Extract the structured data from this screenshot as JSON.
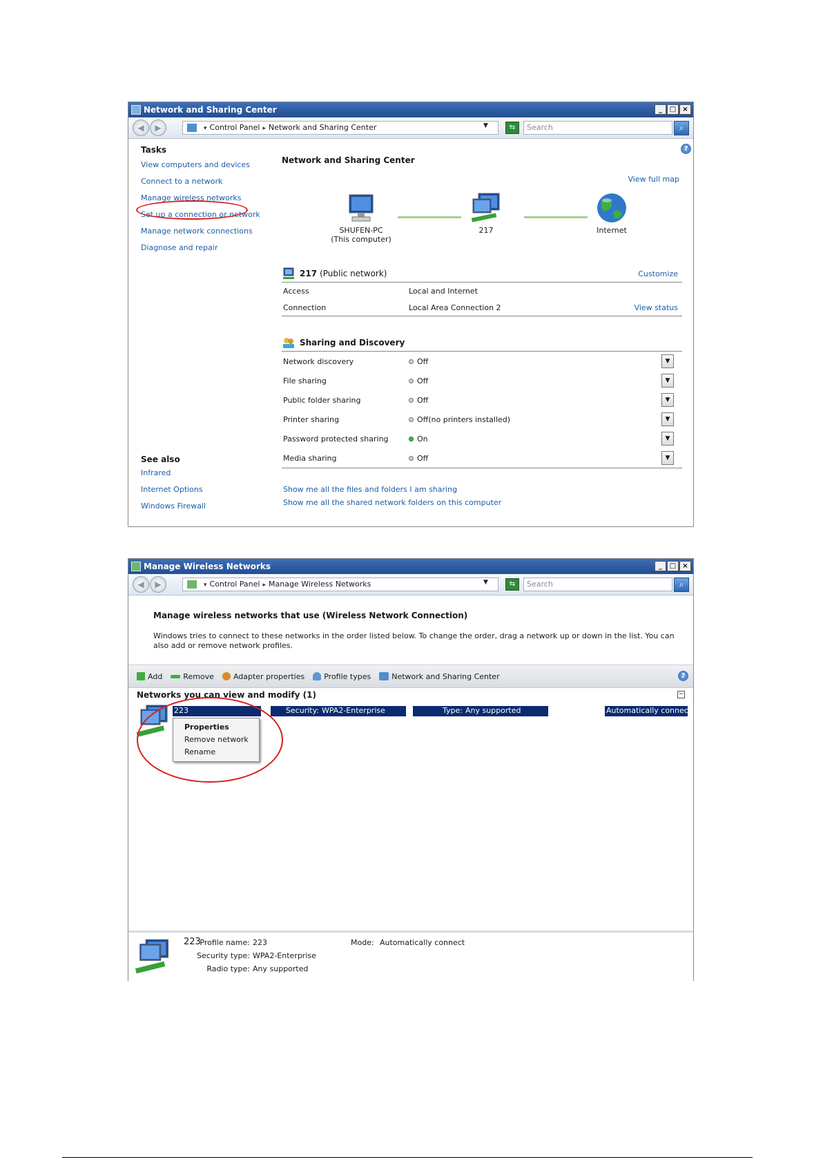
{
  "win1": {
    "title": "Network and Sharing Center",
    "breadcrumb": [
      "Control Panel",
      "Network and Sharing Center"
    ],
    "search_placeholder": "Search",
    "tasks_header": "Tasks",
    "tasks": [
      "View computers and devices",
      "Connect to a network",
      "Manage wireless networks",
      "Set up a connection or network",
      "Manage network connections",
      "Diagnose and repair"
    ],
    "see_also_header": "See also",
    "see_also": [
      "Infrared",
      "Internet Options",
      "Windows Firewall"
    ],
    "main_title": "Network and Sharing Center",
    "view_full_map": "View full map",
    "map": {
      "computer_name": "SHUFEN-PC",
      "computer_sub": "(This computer)",
      "network_name": "217",
      "internet": "Internet"
    },
    "network_section": {
      "name": "217",
      "type": "(Public network)",
      "customize": "Customize",
      "access_label": "Access",
      "access_value": "Local and Internet",
      "connection_label": "Connection",
      "connection_value": "Local Area Connection 2",
      "view_status": "View status"
    },
    "sharing_section": {
      "title": "Sharing and Discovery",
      "rows": [
        {
          "label": "Network discovery",
          "value": "Off",
          "note": ""
        },
        {
          "label": "File sharing",
          "value": "Off",
          "note": ""
        },
        {
          "label": "Public folder sharing",
          "value": "Off",
          "note": ""
        },
        {
          "label": "Printer sharing",
          "value": "Off",
          "note": "(no printers installed)"
        },
        {
          "label": "Password protected sharing",
          "value": "On",
          "note": ""
        },
        {
          "label": "Media sharing",
          "value": "Off",
          "note": ""
        }
      ]
    },
    "bottom_links": [
      "Show me all the files and folders I am sharing",
      "Show me all the shared network folders on this computer"
    ]
  },
  "win2": {
    "title": "Manage Wireless Networks",
    "breadcrumb": [
      "Control Panel",
      "Manage Wireless Networks"
    ],
    "search_placeholder": "Search",
    "heading": "Manage wireless networks that use (Wireless Network Connection)",
    "description": "Windows tries to connect to these networks in the order listed below. To change the order, drag a network up or down in the list. You can also add or remove network profiles.",
    "toolbar": [
      "Add",
      "Remove",
      "Adapter properties",
      "Profile types",
      "Network and Sharing Center"
    ],
    "group_header": "Networks you can view and modify (1)",
    "network": {
      "name": "223",
      "security_label": "Security:",
      "security_value": "WPA2-Enterprise",
      "type_label": "Type:",
      "type_value": "Any supported",
      "connect": "Automatically connect"
    },
    "context_menu": [
      "Properties",
      "Remove network",
      "Rename"
    ],
    "details": {
      "name": "223",
      "profile_label": "Profile name:",
      "profile_value": "223",
      "security_label": "Security type:",
      "security_value": "WPA2-Enterprise",
      "radio_label": "Radio type:",
      "radio_value": "Any supported",
      "mode_label": "Mode:",
      "mode_value": "Automatically connect"
    }
  },
  "colors": {
    "link": "#1c5ca8",
    "selection": "#0b2a6f",
    "annotation": "#d71f1f"
  }
}
